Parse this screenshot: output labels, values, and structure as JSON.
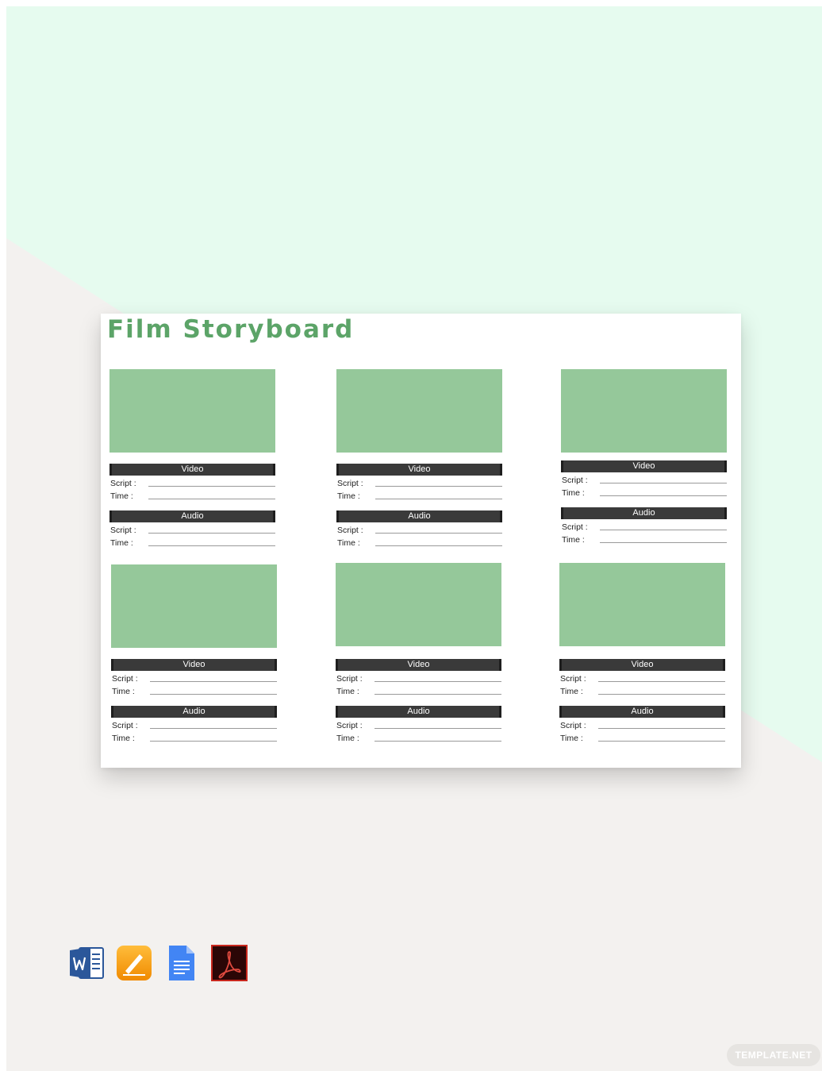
{
  "document": {
    "title": "Film Storyboard",
    "frames": [
      {
        "video_label": "Video",
        "audio_label": "Audio",
        "script_label": "Script :",
        "time_label": "Time :"
      },
      {
        "video_label": "Video",
        "audio_label": "Audio",
        "script_label": "Script :",
        "time_label": "Time :"
      },
      {
        "video_label": "Video",
        "audio_label": "Audio",
        "script_label": "Script :",
        "time_label": "Time :"
      },
      {
        "video_label": "Video",
        "audio_label": "Audio",
        "script_label": "Script :",
        "time_label": "Time :"
      },
      {
        "video_label": "Video",
        "audio_label": "Audio",
        "script_label": "Script :",
        "time_label": "Time :"
      },
      {
        "video_label": "Video",
        "audio_label": "Audio",
        "script_label": "Script :",
        "time_label": "Time :"
      }
    ]
  },
  "format_icons": [
    "word-icon",
    "pages-icon",
    "google-docs-icon",
    "pdf-icon"
  ],
  "watermark": "TEMPLATE.NET",
  "colors": {
    "title_green": "#5ca468",
    "thumb_green": "#95c89a",
    "bar_dark": "#3a3a3a",
    "bg_mint": "#e6fbef",
    "bg_gray": "#f3f1ef"
  }
}
